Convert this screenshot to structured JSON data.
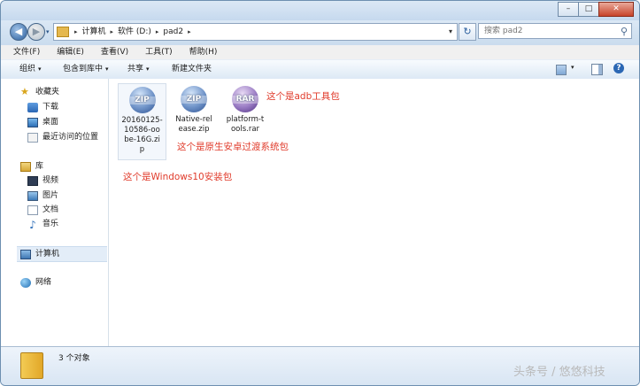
{
  "window": {
    "minimize": "–",
    "maximize": "□",
    "close": "✕"
  },
  "nav": {
    "back_glyph": "◀",
    "forward_glyph": "▶",
    "history_glyph": "▾"
  },
  "address": {
    "breadcrumbs": [
      "计算机",
      "软件 (D:)",
      "pad2"
    ],
    "separator": "▸",
    "dropdown_glyph": "▾",
    "refresh_glyph": "↻"
  },
  "search": {
    "placeholder": "搜索 pad2",
    "icon": "⚲"
  },
  "menu": [
    "文件(F)",
    "编辑(E)",
    "查看(V)",
    "工具(T)",
    "帮助(H)"
  ],
  "toolbar": {
    "organize": "组织",
    "include_in_library": "包含到库中",
    "share": "共享",
    "new_folder": "新建文件夹",
    "dropdown_glyph": "▾",
    "help_glyph": "?"
  },
  "sidebar": {
    "favorites": {
      "header": "收藏夹",
      "items": [
        "下载",
        "桌面",
        "最近访问的位置"
      ]
    },
    "libraries": {
      "header": "库",
      "items": [
        "视频",
        "图片",
        "文档",
        "音乐"
      ]
    },
    "computer": "计算机",
    "network": "网络"
  },
  "files": [
    {
      "name": "20160125-10586-oobe-16G.zip",
      "lines": [
        "20160125-",
        "10586-oo",
        "be-16G.zi",
        "p"
      ],
      "badge": "ZIP",
      "icon": "zip-archive-icon"
    },
    {
      "name": "Native-release.zip",
      "lines": [
        "Native-rel",
        "ease.zip"
      ],
      "badge": "ZIP",
      "icon": "zip-archive-icon"
    },
    {
      "name": "platform-tools.rar",
      "lines": [
        "platform-t",
        "ools.rar"
      ],
      "badge": "RAR",
      "icon": "rar-archive-icon"
    }
  ],
  "annotations": {
    "adb": "这个是adb工具包",
    "native": "这个是原生安卓过渡系统包",
    "windows": "这个是Windows10安装包"
  },
  "status": {
    "count_text": "3 个对象"
  },
  "watermark": "头条号 / 悠悠科技",
  "colors": {
    "annotation": "#e03b2b",
    "selection": "#e3edf8"
  }
}
